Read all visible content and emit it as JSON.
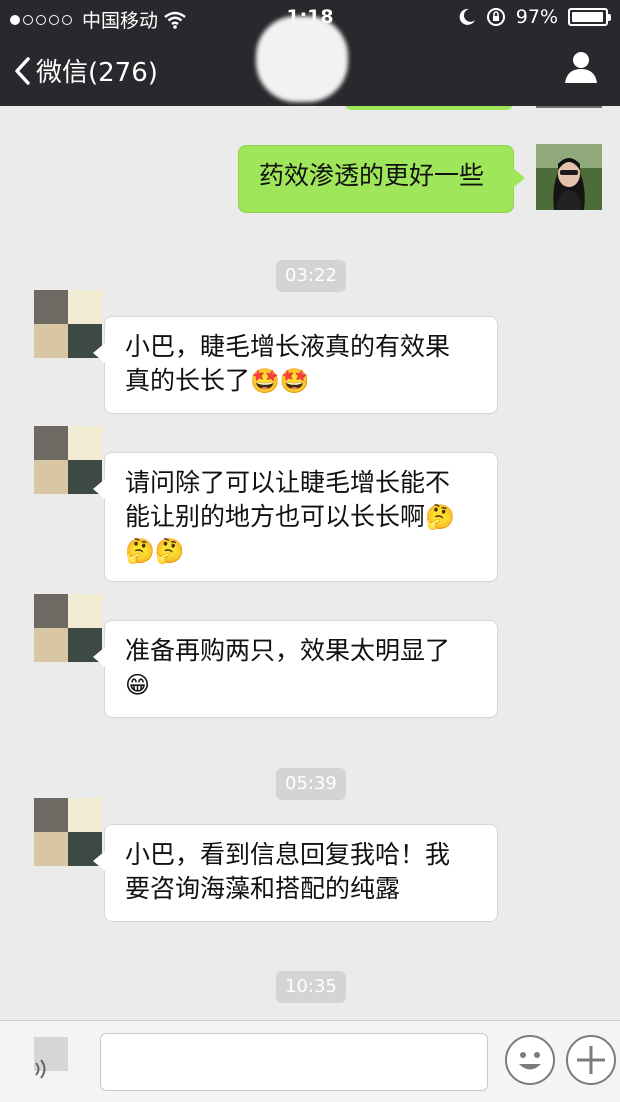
{
  "status_bar": {
    "carrier": "中国移动",
    "time": "1:18",
    "battery": "97%",
    "battery_level": 0.97
  },
  "nav": {
    "back_label": "微信(276)"
  },
  "messages": [
    {
      "type": "out",
      "text": "药效渗透的更好一些"
    },
    {
      "type": "time",
      "text": "03:22"
    },
    {
      "type": "in",
      "lines": [
        "小巴，睫毛增长液真的有效果",
        "真的长长了"
      ],
      "emoji": "🤩🤩"
    },
    {
      "type": "in",
      "lines": [
        "请问除了可以让睫毛增长能不",
        "能让别的地方也可以长长啊"
      ],
      "emoji_inline": "🤔",
      "emoji": "🤔🤔"
    },
    {
      "type": "in",
      "lines": [
        "准备再购两只，效果太明显了"
      ],
      "emoji": "😁"
    },
    {
      "type": "time",
      "text": "05:39"
    },
    {
      "type": "in",
      "lines": [
        "小巴，看到信息回复我哈！我",
        "要咨询海藻和搭配的纯露"
      ]
    },
    {
      "type": "time",
      "text": "10:35"
    }
  ],
  "icons": {
    "back": "chevron-left-icon",
    "contact": "person-icon",
    "wifi": "wifi-icon",
    "moon": "moon-icon",
    "rotation_lock": "rotation-lock-icon",
    "emoji": "smiley-icon",
    "add": "plus-icon",
    "voice": "voice-icon"
  },
  "colors": {
    "nav_bg": "#27292c",
    "chat_bg": "#ebebeb",
    "out_bubble": "#9fe65a",
    "in_bubble": "#ffffff",
    "timestamp_bg": "#d4d4d4"
  }
}
